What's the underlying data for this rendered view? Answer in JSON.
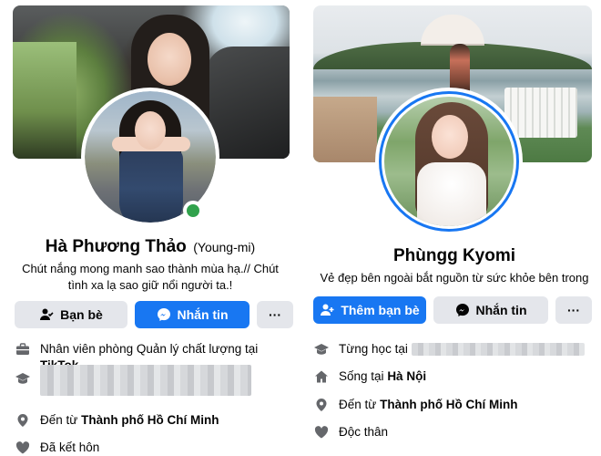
{
  "left_profile": {
    "name": "Hà Phương Thảo",
    "alt_name": "(Young-mi)",
    "bio_line1": "Chút nắng mong manh sao thành mùa hạ.// Chút",
    "bio_line2": "tình xa lạ sao giữ nổi người ta.!",
    "online": true,
    "buttons": {
      "friends": "Bạn bè",
      "message": "Nhắn tin",
      "more": "···"
    },
    "info": {
      "work_prefix": "Nhân viên phòng Quản lý chất lượng tại",
      "work_company": "TikTok",
      "from_prefix": "Đến từ",
      "from_place": "Thành phố Hồ Chí Minh",
      "relationship": "Đã kết hôn"
    }
  },
  "right_profile": {
    "name": "Phùngg Kyomi",
    "bio": "Vẻ đẹp bên ngoài bắt nguồn từ sức khỏe bên trong",
    "buttons": {
      "add_friend": "Thêm bạn bè",
      "message": "Nhắn tin",
      "more": "···"
    },
    "info": {
      "studied_prefix": "Từng học tại",
      "lives_prefix": "Sống tại",
      "lives_place": "Hà Nội",
      "from_prefix": "Đến từ",
      "from_place": "Thành phố Hồ Chí Minh",
      "relationship": "Độc thân"
    }
  },
  "colors": {
    "primary_blue": "#1877f2",
    "button_gray": "#e4e6eb",
    "online_green": "#31a24c",
    "icon_gray": "#65676b"
  }
}
